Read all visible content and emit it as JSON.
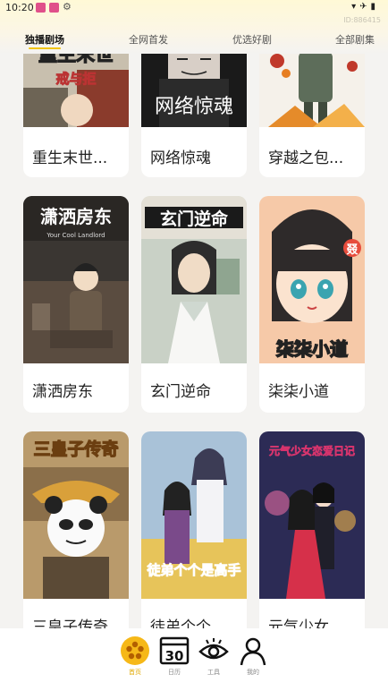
{
  "status_bar": {
    "time": "10:20",
    "user_id": "ID:886415"
  },
  "tabs": [
    {
      "label": "独播剧场",
      "active": true
    },
    {
      "label": "全网首发",
      "active": false
    },
    {
      "label": "优选好剧",
      "active": false
    },
    {
      "label": "全部剧集",
      "active": false
    }
  ],
  "grid": {
    "row1": [
      {
        "title": "重生末世...",
        "poster_text": "重生末世",
        "poster_sub": "戒与拒"
      },
      {
        "title": "网络惊魂",
        "poster_text": "网络惊魂"
      },
      {
        "title": "穿越之包..."
      }
    ],
    "row2": [
      {
        "title": "潇洒房东",
        "poster_text": "潇洒房东",
        "poster_sub": "Your Cool Landlord"
      },
      {
        "title": "玄门逆命",
        "poster_text": "玄门逆命"
      },
      {
        "title": "柒柒小道",
        "poster_text": "柒柒小道",
        "poster_badge": "叕"
      }
    ],
    "row3": [
      {
        "title": "三皇子传奇",
        "poster_text": "三皇子传奇"
      },
      {
        "title": "徒弟个个...",
        "poster_text": "徒弟个个是高手"
      },
      {
        "title": "元气少女...",
        "poster_text": "元气少女恋爱日记"
      }
    ]
  },
  "bottom_nav": [
    {
      "label": "首页",
      "icon": "home-flower-icon",
      "active": true
    },
    {
      "label": "日历",
      "icon": "calendar-icon",
      "calendar_day": "30",
      "active": false
    },
    {
      "label": "工具",
      "icon": "eye-icon",
      "active": false
    },
    {
      "label": "我的",
      "icon": "user-icon",
      "active": false
    }
  ],
  "colors": {
    "accent": "#f1c40f",
    "background": "#f4f3f1",
    "card": "#ffffff"
  }
}
